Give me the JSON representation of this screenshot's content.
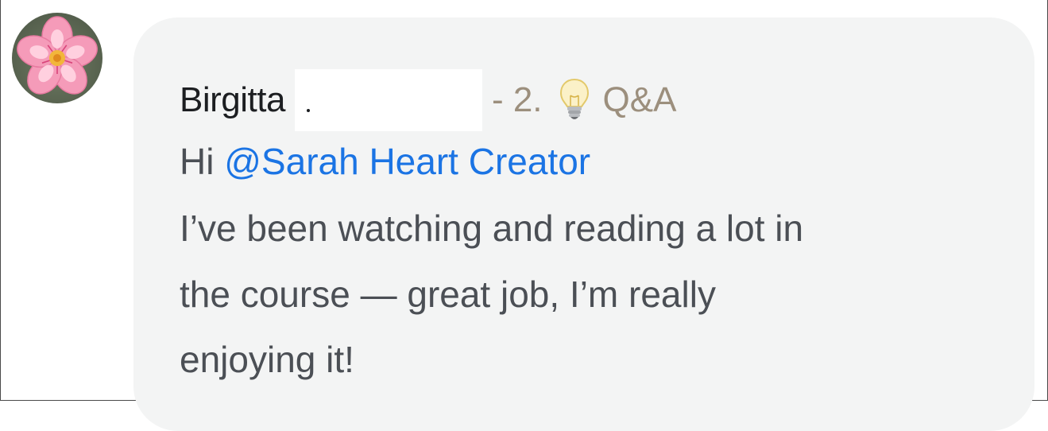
{
  "comment": {
    "author": "Birgitta",
    "meta": {
      "dash": "- 2.",
      "icon": "lightbulb-icon",
      "category": "Q&A"
    },
    "greeting_word": "Hi",
    "mention": "@Sarah Heart Creator",
    "body_lines": [
      "I’ve been watching and reading a lot in",
      "the course — great job, I’m really",
      "enjoying it!"
    ]
  },
  "avatar": {
    "icon": "cherry-blossom-icon"
  },
  "colors": {
    "bubble": "#f3f4f4",
    "mention": "#1b74e4",
    "meta": "#9c8f7d",
    "text": "#4b4f55",
    "author": "#1c1e21"
  }
}
